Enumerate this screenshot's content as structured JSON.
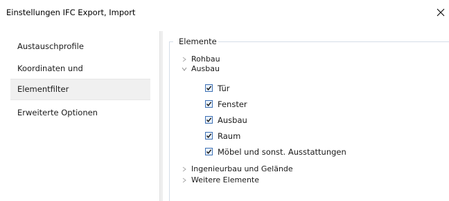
{
  "window": {
    "title": "Einstellungen IFC Export, Import"
  },
  "sidebar": {
    "items": [
      {
        "label": "Austauschprofile",
        "selected": false
      },
      {
        "label": "Koordinaten und Längenparameter",
        "selected": false
      },
      {
        "label": "Elementfilter",
        "selected": true
      },
      {
        "label": "Erweiterte Optionen",
        "selected": false
      }
    ]
  },
  "elements_group": {
    "label": "Elemente",
    "tree": [
      {
        "label": "Rohbau",
        "expanded": false
      },
      {
        "label": "Ausbau",
        "expanded": true
      },
      {
        "label": "Ingenieurbau und Gelände",
        "expanded": false
      },
      {
        "label": "Weitere Elemente",
        "expanded": false
      }
    ],
    "ausbau_children": [
      {
        "label": "Tür",
        "checked": true
      },
      {
        "label": "Fenster",
        "checked": true
      },
      {
        "label": "Ausbau",
        "checked": true
      },
      {
        "label": "Raum",
        "checked": true
      },
      {
        "label": "Möbel und sonst. Ausstattungen",
        "checked": true
      }
    ]
  },
  "colors": {
    "checkbox_border": "#3c6fb4",
    "selected_bg": "#f0f0f0",
    "group_border": "#d5dde7"
  }
}
